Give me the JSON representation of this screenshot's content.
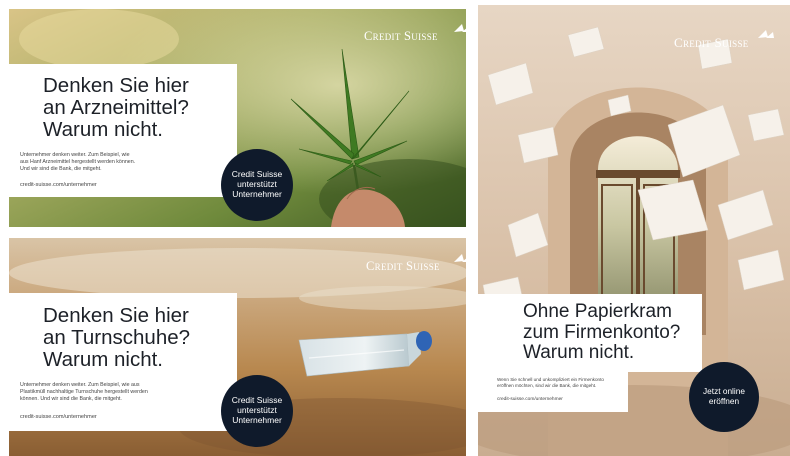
{
  "brand": {
    "logo_text": "Credit Suisse"
  },
  "ads": {
    "cannabis": {
      "headline": [
        "Denken Sie hier",
        "an Arzneimittel?",
        "Warum nicht."
      ],
      "body": [
        "Unternehmer denken weiter. Zum Beispiel, wie",
        "aus Hanf Arzneimittel hergestellt werden können.",
        "Und wir sind die Bank, die mitgeht."
      ],
      "url": "credit-suisse.com/unternehmer",
      "badge": [
        "Credit Suisse",
        "unterstützt",
        "Unternehmer"
      ]
    },
    "bottle": {
      "headline": [
        "Denken Sie hier",
        "an Turnschuhe?",
        "Warum nicht."
      ],
      "body": [
        "Unternehmer denken weiter. Zum Beispiel, wie aus",
        "Plastikmüll nachhaltige Turnschuhe hergestellt werden",
        "können. Und wir sind die Bank, die mitgeht."
      ],
      "url": "credit-suisse.com/unternehmer",
      "badge": [
        "Credit Suisse",
        "unterstützt",
        "Unternehmer"
      ]
    },
    "door": {
      "headline": [
        "Ohne Papierkram",
        "zum Firmenkonto?",
        "Warum nicht."
      ],
      "body": [
        "Wenn Sie schnell und unkompliziert ein Firmenkonto",
        "eröffnen möchten, sind wir die Bank, die mitgeht."
      ],
      "url": "credit-suisse.com/unternehmer",
      "badge": [
        "Jetzt online",
        "eröffnen"
      ]
    }
  }
}
